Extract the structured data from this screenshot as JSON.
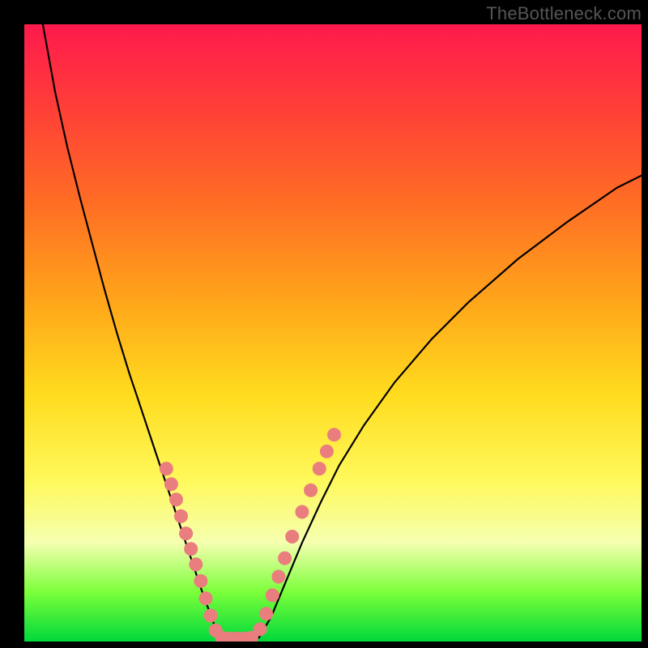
{
  "watermark": "TheBottleneck.com",
  "colors": {
    "curve": "#000000",
    "dot_fill": "#ea7d7d",
    "dot_stroke": "#c85a5a"
  },
  "chart_data": {
    "type": "line",
    "title": "",
    "xlabel": "",
    "ylabel": "",
    "xlim": [
      0,
      100
    ],
    "ylim": [
      0,
      100
    ],
    "series": [
      {
        "name": "left-branch",
        "x": [
          3,
          5,
          7,
          9,
          11,
          13,
          15,
          17,
          18.5,
          20,
          21.5,
          23,
          24.5,
          26,
          27.5,
          29,
          30.5,
          31.5
        ],
        "y": [
          100,
          89,
          80,
          72,
          64.5,
          57,
          50,
          43.5,
          39,
          34.5,
          30,
          25.5,
          21,
          16.5,
          12,
          7.5,
          3.5,
          0.5
        ]
      },
      {
        "name": "valley-floor",
        "x": [
          31.5,
          33,
          34.5,
          36,
          37,
          38
        ],
        "y": [
          0.5,
          0.3,
          0.3,
          0.3,
          0.4,
          0.6
        ]
      },
      {
        "name": "right-branch",
        "x": [
          38,
          40,
          42.5,
          45,
          48,
          51,
          55,
          60,
          66,
          72,
          80,
          88,
          96,
          100
        ],
        "y": [
          0.6,
          4,
          10,
          16,
          22.5,
          28.5,
          35,
          42,
          49,
          55,
          62,
          68,
          73.5,
          75.5
        ]
      }
    ],
    "annotations": {
      "dots_left_branch": [
        {
          "x": 23.0,
          "y": 28.0
        },
        {
          "x": 23.8,
          "y": 25.5
        },
        {
          "x": 24.6,
          "y": 23.0
        },
        {
          "x": 25.4,
          "y": 20.3
        },
        {
          "x": 26.2,
          "y": 17.5
        },
        {
          "x": 27.0,
          "y": 15.0
        },
        {
          "x": 27.8,
          "y": 12.5
        },
        {
          "x": 28.6,
          "y": 9.8
        },
        {
          "x": 29.4,
          "y": 7.0
        },
        {
          "x": 30.2,
          "y": 4.2
        },
        {
          "x": 31.0,
          "y": 1.8
        }
      ],
      "dots_valley": [
        {
          "x": 32.0,
          "y": 0.6
        },
        {
          "x": 33.2,
          "y": 0.5
        },
        {
          "x": 34.4,
          "y": 0.5
        },
        {
          "x": 35.6,
          "y": 0.5
        },
        {
          "x": 36.8,
          "y": 0.6
        }
      ],
      "dots_right_branch": [
        {
          "x": 38.2,
          "y": 2.0
        },
        {
          "x": 39.2,
          "y": 4.5
        },
        {
          "x": 40.2,
          "y": 7.5
        },
        {
          "x": 41.2,
          "y": 10.5
        },
        {
          "x": 42.2,
          "y": 13.5
        },
        {
          "x": 43.4,
          "y": 17.0
        },
        {
          "x": 45.0,
          "y": 21.0
        },
        {
          "x": 46.4,
          "y": 24.5
        },
        {
          "x": 47.8,
          "y": 28.0
        },
        {
          "x": 49.0,
          "y": 30.8
        },
        {
          "x": 50.2,
          "y": 33.5
        }
      ]
    }
  }
}
